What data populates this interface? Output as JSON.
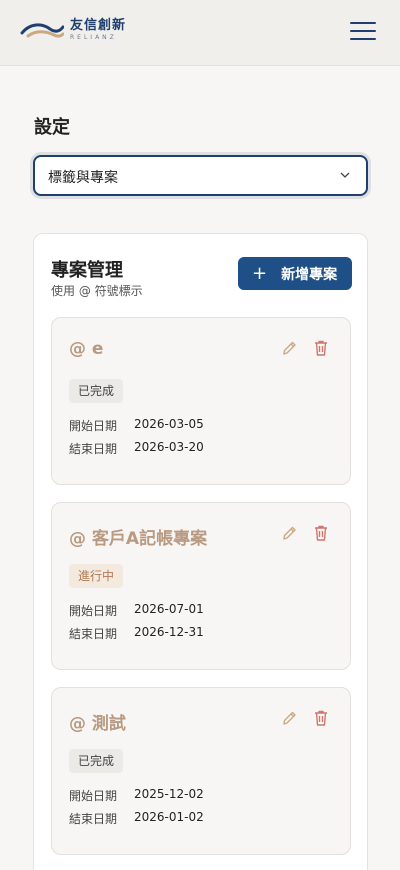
{
  "header": {
    "logo_cn": "友信創新",
    "logo_en": "RELIANZ",
    "colors": {
      "brand": "#1f3f6e",
      "accent": "#c9a882"
    }
  },
  "page": {
    "title": "設定"
  },
  "settings_select": {
    "value": "標籤與專案"
  },
  "projects_panel": {
    "title": "專案管理",
    "subtitle": "使用 @ 符號標示",
    "add_button_label": "新增專案",
    "start_label": "開始日期",
    "end_label": "結束日期",
    "projects": [
      {
        "name": "@ e",
        "status": "已完成",
        "start": "2026-03-05",
        "end": "2026-03-20"
      },
      {
        "name": "@ 客戶A記帳專案",
        "status": "進行中",
        "start": "2026-07-01",
        "end": "2026-12-31"
      },
      {
        "name": "@ 測試",
        "status": "已完成",
        "start": "2025-12-02",
        "end": "2026-01-02"
      }
    ]
  }
}
